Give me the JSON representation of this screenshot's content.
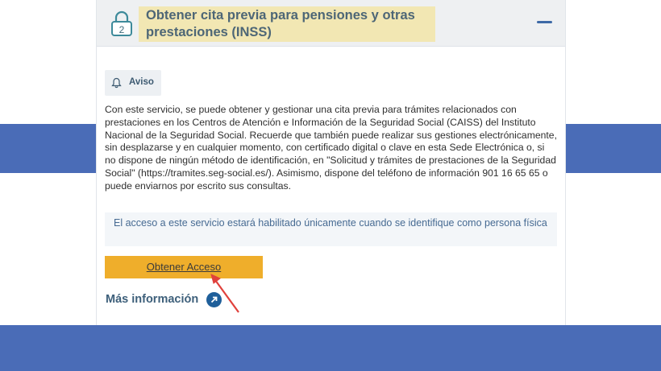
{
  "header": {
    "step_number": "2",
    "title": "Obtener cita previa para pensiones y otras prestaciones (INSS)"
  },
  "aviso": {
    "label": "Aviso",
    "icon": "bell-icon"
  },
  "description": "Con este servicio, se puede obtener y gestionar una cita previa para trámites relacionados con prestaciones en los Centros de Atención e Información de la Seguridad Social (CAISS) del Instituto Nacional de la Seguridad Social. Recuerde que también puede realizar sus gestiones electrónicamente, sin desplazarse y en cualquier momento, con certificado digital o clave en esta Sede Electrónica o, si no dispone de ningún método de identificación, en \"Solicitud y trámites de prestaciones de la Seguridad Social\" (https://tramites.seg-social.es/). Asimismo, dispone del teléfono de información 901 16 65 65 o puede enviarnos por escrito sus consultas.",
  "notice": "El acceso a este servicio estará habilitado únicamente cuando se identifique como persona física",
  "access_button": "Obtener Acceso",
  "more_info": "Más información",
  "colors": {
    "band": "#4a6cb7",
    "title_highlight": "#f2e7b3",
    "access_button": "#efae2b",
    "annotation_arrow": "#e0413c"
  }
}
